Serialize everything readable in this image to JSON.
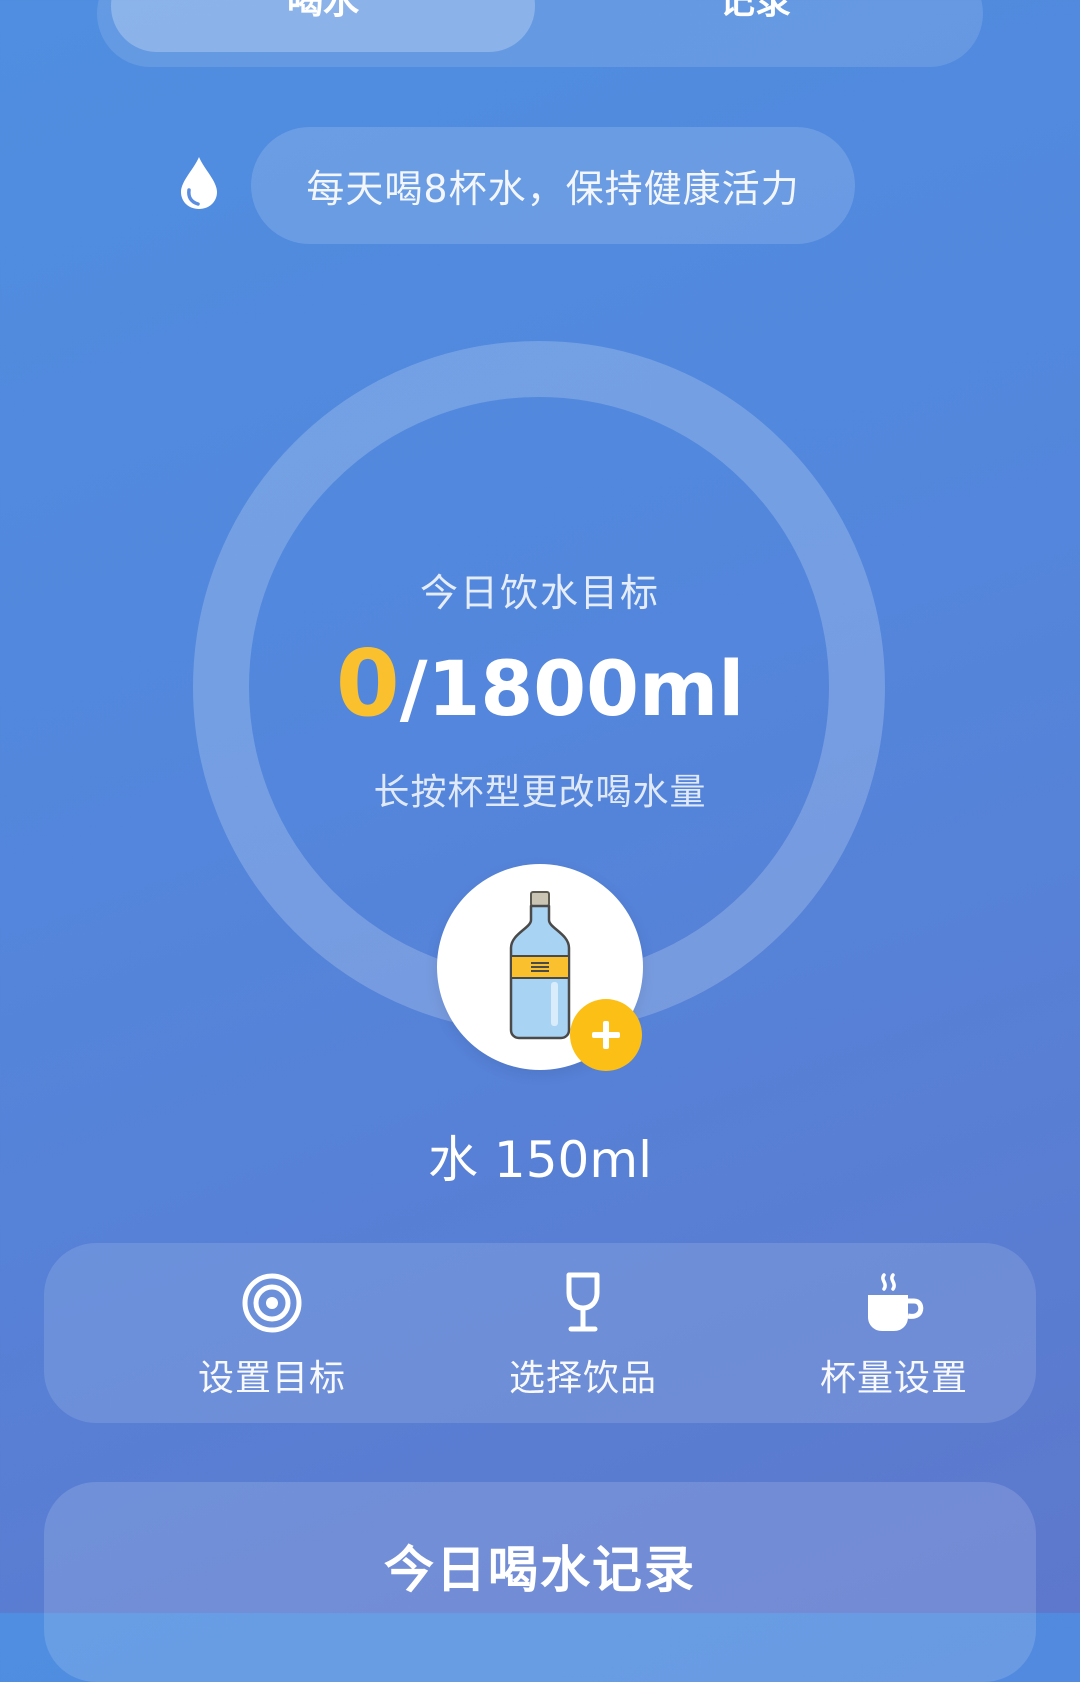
{
  "tabs": {
    "drink_label": "喝水",
    "record_label": "记录"
  },
  "tip": {
    "text": "每天喝8杯水，保持健康活力",
    "icon": "water-drop-icon"
  },
  "progress": {
    "label": "今日饮水目标",
    "current_value": "0",
    "goal_text": "/1800ml",
    "fraction": 0,
    "hint": "长按杯型更改喝水量"
  },
  "cup": {
    "icon": "water-bottle-icon",
    "label": "水 150ml",
    "add_icon": "plus-icon"
  },
  "actions": [
    {
      "label": "设置目标",
      "icon": "target-icon"
    },
    {
      "label": "选择饮品",
      "icon": "wine-glass-icon"
    },
    {
      "label": "杯量设置",
      "icon": "coffee-cup-icon"
    }
  ],
  "record": {
    "title": "今日喝水记录"
  },
  "colors": {
    "accent": "#fbc02d",
    "background_top": "#4f8ee0",
    "background_bottom": "#5d78cc"
  }
}
